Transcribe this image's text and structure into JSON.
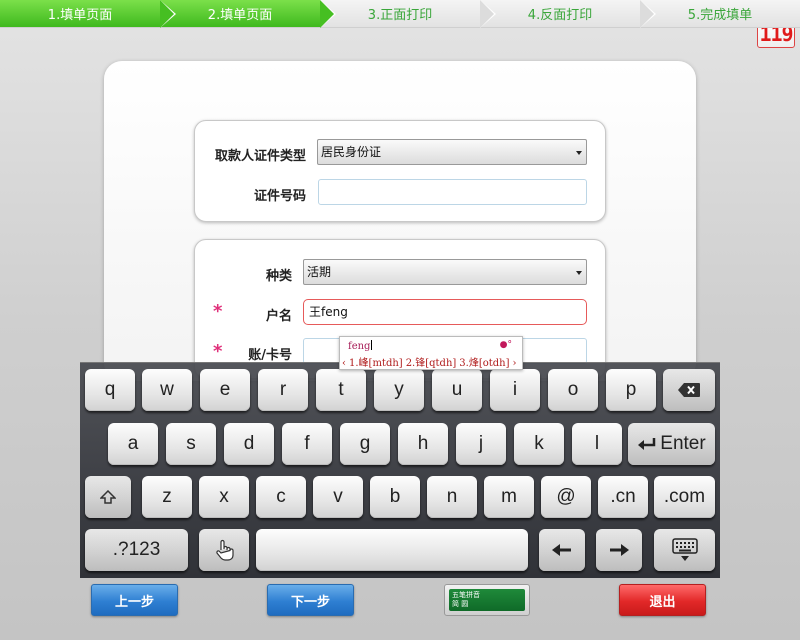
{
  "steps": [
    {
      "label": "1.填单页面",
      "done": true
    },
    {
      "label": "2.填单页面",
      "done": true
    },
    {
      "label": "3.正面打印",
      "done": false
    },
    {
      "label": "4.反面打印",
      "done": false
    },
    {
      "label": "5.完成填单",
      "done": false
    }
  ],
  "timer": "119",
  "form": {
    "id_type_label": "取款人证件类型",
    "id_type_value": "居民身份证",
    "id_number_label": "证件号码",
    "id_number_value": "",
    "category_label": "种类",
    "category_value": "活期",
    "name_label": "户名",
    "name_value": "王feng",
    "account_label": "账/卡号",
    "account_value": "",
    "required_mark": "*"
  },
  "ime": {
    "composition": "feng",
    "status_glyphs": "●°",
    "prev_arrow": "‹",
    "next_arrow": "›",
    "candidates": [
      "1.峰[mtdh]",
      "2.锋[qtdh]",
      "3.烽[otdh]"
    ]
  },
  "keyboard": {
    "row1": [
      "q",
      "w",
      "e",
      "r",
      "t",
      "y",
      "u",
      "i",
      "o",
      "p"
    ],
    "row2": [
      "a",
      "s",
      "d",
      "f",
      "g",
      "h",
      "j",
      "k",
      "l"
    ],
    "row3": [
      "z",
      "x",
      "c",
      "v",
      "b",
      "n",
      "m",
      "@",
      ".cn",
      ".com"
    ],
    "enter_label": "Enter",
    "numeric_label": ".?123"
  },
  "buttons": {
    "prev": "上一步",
    "next": "下一步",
    "exit": "退出",
    "ime_switch_line1": "五笔拼音",
    "ime_switch_line2": "简 圆"
  },
  "colors": {
    "step_done": "#46bf22",
    "step_pending_text": "#3aa63a",
    "required": "#e0307a",
    "timer": "#e01b1b",
    "primary_button": "#2e7fd2",
    "danger_button": "#e22828"
  }
}
